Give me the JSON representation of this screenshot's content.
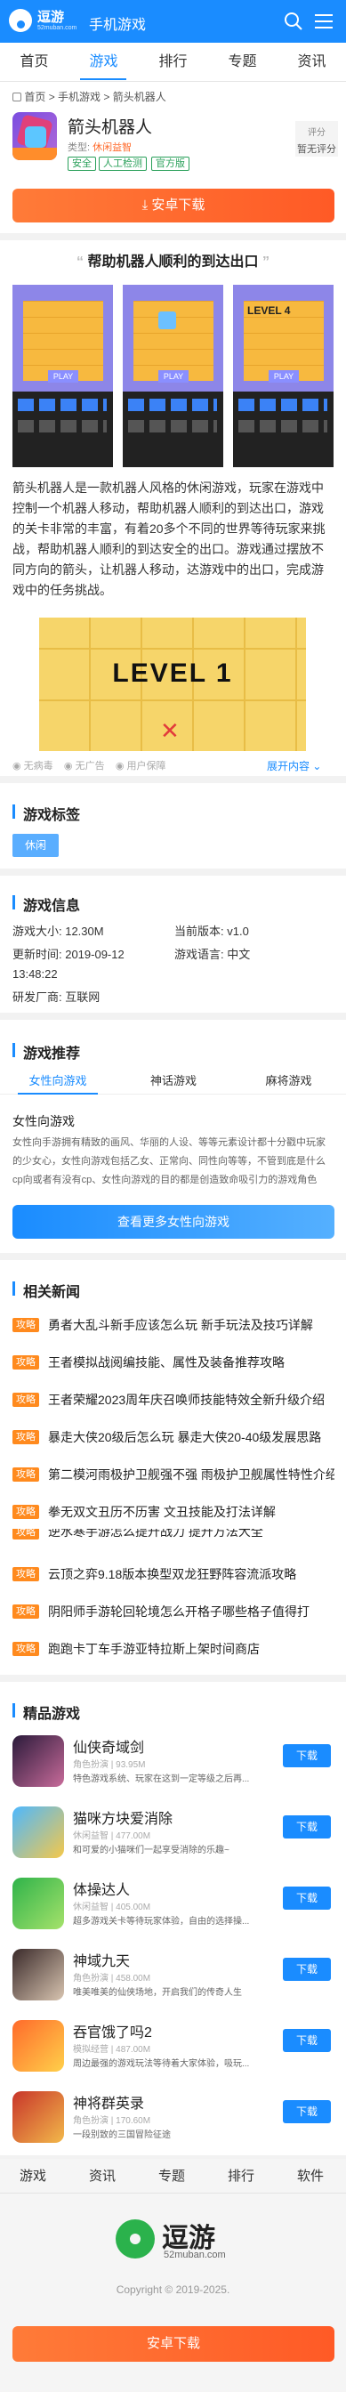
{
  "header": {
    "logo_cn": "逗游",
    "logo_en": "52muban.com",
    "title": "手机游戏"
  },
  "nav": [
    "首页",
    "游戏",
    "排行",
    "专题",
    "资讯"
  ],
  "breadcrumb": [
    "首页",
    "手机游戏",
    "箭头机器人"
  ],
  "game": {
    "name": "箭头机器人",
    "type_label": "类型:",
    "type_value": "休闲益智",
    "tags": [
      "安全",
      "人工检测",
      "官方版"
    ],
    "score_label": "评分",
    "score_value": "暂无评分",
    "download_label": "安卓下载",
    "promo_title": "帮助机器人顺利的到达出口",
    "description": "箭头机器人是一款机器人风格的休闲游戏，玩家在游戏中控制一个机器人移动，帮助机器人顺利的到达出口，游戏的关卡非常的丰富，有着20多个不同的世界等待玩家来挑战，帮助机器人顺利的到达安全的出口。游戏通过摆放不同方向的箭头，让机器人移动，达游戏中的出口，完成游戏中的任务挑战。",
    "screenshot_level_text": "LEVEL 1",
    "level_small": "LEVEL 4",
    "play_label": "PLAY",
    "meta_row": [
      "无病毒",
      "无广告",
      "用户保障"
    ],
    "expand_label": "展开内容"
  },
  "tags_section": {
    "title": "游戏标签",
    "tags": [
      "休闲"
    ]
  },
  "info_section": {
    "title": "游戏信息",
    "rows": [
      [
        "游戏大小: 12.30M",
        "当前版本: v1.0"
      ],
      [
        "更新时间: 2019-09-12 13:48:22",
        "游戏语言: 中文"
      ],
      [
        "研发厂商: 互联网",
        ""
      ]
    ]
  },
  "recommend_section": {
    "title": "游戏推荐",
    "tabs": [
      "女性向游戏",
      "神话游戏",
      "麻将游戏"
    ],
    "topic_title": "女性向游戏",
    "topic_desc": "女性向手游拥有精致的画风、华丽的人设、等等元素设计都十分戳中玩家的少女心，女性向游戏包括乙女、正常向、同性向等等，不管到底是什么cp向或者有没有cp、女性向游戏的目的都是创造致命吸引力的游戏角色",
    "more_button": "查看更多女性向游戏"
  },
  "news_section": {
    "title": "相关新闻",
    "badge": "攻略",
    "items": [
      "勇者大乱斗新手应该怎么玩 新手玩法及技巧详解",
      "王者模拟战阅编技能、属性及装备推荐攻略",
      "王者荣耀2023周年庆召唤师技能特效全新升级介绍",
      "暴走大侠20级后怎么玩 暴走大侠20-40级发展思路",
      "第二模河雨极护卫舰强不强 雨极护卫舰属性特性介绍",
      "拳无双文丑历不历害 文丑技能及打法详解",
      "逆水寒手游怎么提升战力 提升方法大全",
      "云顶之弈9.18版本换型双龙狂野阵容流派攻略",
      "阴阳师手游轮回轮境怎么开格子哪些格子值得打",
      "跑跑卡丁车手游亚特拉斯上架时间商店"
    ]
  },
  "apps_section": {
    "title": "精品游戏",
    "download_label": "下载",
    "items": [
      {
        "name": "仙侠奇域剑",
        "meta": "角色扮演 | 93.95M",
        "desc": "特色游戏系统、玩家在这到一定等级之后再..."
      },
      {
        "name": "猫咪方块爱消除",
        "meta": "休闲益智 | 477.00M",
        "desc": "和可爱的小猫咪们一起享受消除的乐趣~"
      },
      {
        "name": "体操达人",
        "meta": "休闲益智 | 405.00M",
        "desc": "超多游戏关卡等待玩家体验，自由的选择操..."
      },
      {
        "name": "神域九天",
        "meta": "角色扮演 | 458.00M",
        "desc": "唯美唯美的仙侠场地，开启我们的传奇人生"
      },
      {
        "name": "吞官饿了吗2",
        "meta": "模拟经营 | 487.00M",
        "desc": "周边最强的游戏玩法等待着大家体验，吸玩..."
      },
      {
        "name": "神将群英录",
        "meta": "角色扮演 | 170.60M",
        "desc": "一段别致的三国冒险征途"
      }
    ]
  },
  "footer": {
    "nav": [
      "游戏",
      "资讯",
      "专题",
      "排行",
      "软件"
    ],
    "logo_cn": "逗游",
    "logo_en": "52muban.com",
    "copyright": "Copyright © 2019-2025.",
    "download_label": "安卓下载"
  },
  "colors": {
    "primary": "#1a8cff",
    "orange": "#ff6a2b",
    "green": "#2aa05a",
    "news_badge": "#ff8a1e"
  }
}
